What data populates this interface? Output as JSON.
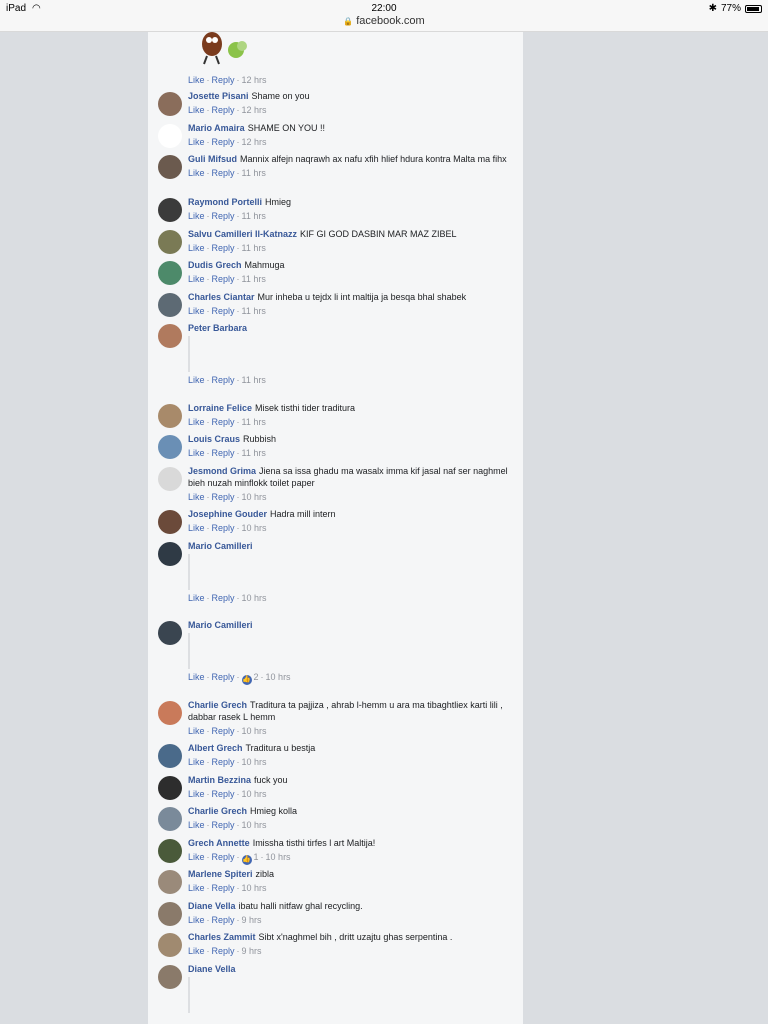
{
  "status_bar": {
    "device": "iPad",
    "time": "22:00",
    "url": "facebook.com",
    "battery": "77%",
    "battery_level": 0.77
  },
  "actions": {
    "like": "Like",
    "reply": "Reply",
    "sep": "·"
  },
  "top_actions": {
    "time": "12 hrs"
  },
  "comments": [
    {
      "name": "Josette Pisani",
      "text": "Shame on you",
      "time": "12 hrs",
      "avatar_color": "#8a6d5b"
    },
    {
      "name": "Mario Amaira",
      "text": "SHAME ON YOU !!",
      "time": "12 hrs",
      "avatar_color": "#ffffff"
    },
    {
      "name": "Guli Mifsud",
      "text": "Mannix alfejn naqrawh ax nafu xfih hlief hdura kontra Malta ma fihx",
      "time": "11 hrs",
      "avatar_color": "#6b5a4e"
    },
    {
      "name": "Raymond Portelli",
      "text": "Hmieg",
      "time": "11 hrs",
      "avatar_color": "#3b3b3b"
    },
    {
      "name": "Salvu Camilleri Il-Katnazz",
      "text": "KIF GI GOD DASBIN MAR MAZ ZIBEL",
      "time": "11 hrs",
      "avatar_color": "#7a7a55"
    },
    {
      "name": "Dudis Grech",
      "text": "Mahmuga",
      "time": "11 hrs",
      "avatar_color": "#4d8a6a"
    },
    {
      "name": "Charles Ciantar",
      "text": "Mur inheba u tejdx li int maltija ja besqa bhal shabek",
      "time": "11 hrs",
      "avatar_color": "#5d6a74"
    },
    {
      "name": "Peter Barbara",
      "text": "",
      "time": "11 hrs",
      "avatar_color": "#b07a5e"
    },
    {
      "name": "Lorraine Felice",
      "text": "Misek tisthi tider traditura",
      "time": "11 hrs",
      "avatar_color": "#a88a6a"
    },
    {
      "name": "Louis Craus",
      "text": "Rubbish",
      "time": "11 hrs",
      "avatar_color": "#6a8fb5"
    },
    {
      "name": "Jesmond Grima",
      "text": "Jiena sa issa ghadu ma wasalx imma kif jasal naf ser naghmel bieh nuzah minflokk toilet paper",
      "time": "10 hrs",
      "avatar_color": "#d9d9d9"
    },
    {
      "name": "Josephine Gouder",
      "text": "Hadra mill intern",
      "time": "10 hrs",
      "avatar_color": "#6b4a3a"
    },
    {
      "name": "Mario Camilleri",
      "text": "",
      "time": "10 hrs",
      "avatar_color": "#2f3a45"
    },
    {
      "name": "Mario Camilleri",
      "text": "",
      "time": "10 hrs",
      "reactions": "2",
      "avatar_color": "#3a4550"
    },
    {
      "name": "Charlie Grech",
      "text": "Traditura ta pajjiza , ahrab l-hemm u ara ma tibaghtliex karti lili , dabbar rasek L hemm",
      "time": "10 hrs",
      "avatar_color": "#c97a5a"
    },
    {
      "name": "Albert Grech",
      "text": "Traditura u bestja",
      "time": "10 hrs",
      "avatar_color": "#4a6a8a"
    },
    {
      "name": "Martin Bezzina",
      "text": "fuck you",
      "time": "10 hrs",
      "avatar_color": "#2d2d2d"
    },
    {
      "name": "Charlie Grech",
      "text": "Hmieg kolla",
      "time": "10 hrs",
      "avatar_color": "#7a8a9a"
    },
    {
      "name": "Grech Annette",
      "text": "Imissha tisthi tirfes l art Maltija!",
      "time": "10 hrs",
      "reactions": "1",
      "avatar_color": "#4a5a3a"
    },
    {
      "name": "Marlene Spiteri",
      "text": "zibla",
      "time": "10 hrs",
      "avatar_color": "#9a8a7a"
    },
    {
      "name": "Diane Vella",
      "text": "ibatu halli nitfaw ghal recycling.",
      "time": "9 hrs",
      "avatar_color": "#8a7a6a"
    },
    {
      "name": "Charles Zammit",
      "text": "Sibt x'naghmel bih , dritt uzajtu ghas serpentina .",
      "time": "9 hrs",
      "avatar_color": "#a08a70"
    },
    {
      "name": "Diane Vella",
      "text": "",
      "time": "",
      "avatar_color": "#8a7a6a"
    }
  ]
}
